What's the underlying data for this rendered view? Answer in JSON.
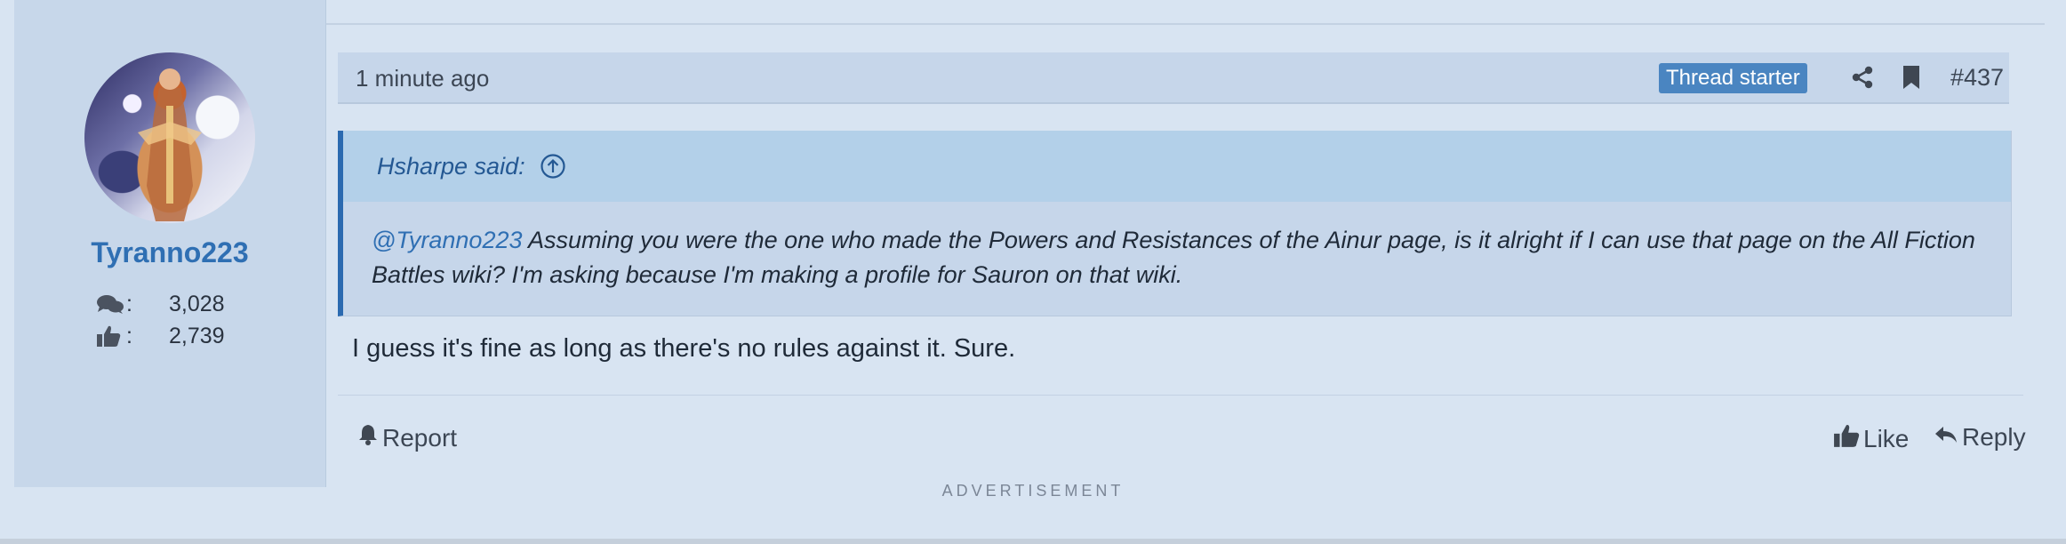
{
  "post": {
    "user": {
      "username": "Tyranno223",
      "messages_icon": "comments-icon",
      "reactions_icon": "thumbs-up-icon",
      "messages_label": ":",
      "reactions_label": ":",
      "message_count": "3,028",
      "reaction_score": "2,739"
    },
    "meta": {
      "time": "1 minute ago",
      "badge": "Thread starter",
      "share_icon": "share-icon",
      "bookmark_icon": "bookmark-icon",
      "post_number": "#437"
    },
    "quote": {
      "author_line": "Hsharpe said:",
      "expand_icon": "arrow-up-circle-icon",
      "mention": "@Tyranno223",
      "text": " Assuming you were the one who made the Powers and Resistances of the Ainur page, is it alright if I can use that page on the All Fiction Battles wiki? I'm asking because I'm making a profile for Sauron on that wiki."
    },
    "message": "I guess it's fine as long as there's no rules against it. Sure.",
    "actions": {
      "report": "Report",
      "like": "Like",
      "reply": "Reply"
    }
  },
  "advertisement_label": "ADVERTISEMENT",
  "colors": {
    "background": "#d8e4f2",
    "user_cell": "#c7d7ea",
    "accent": "#2f6fb3",
    "badge": "#4a85c1",
    "quote_header": "#b3d0e9"
  }
}
